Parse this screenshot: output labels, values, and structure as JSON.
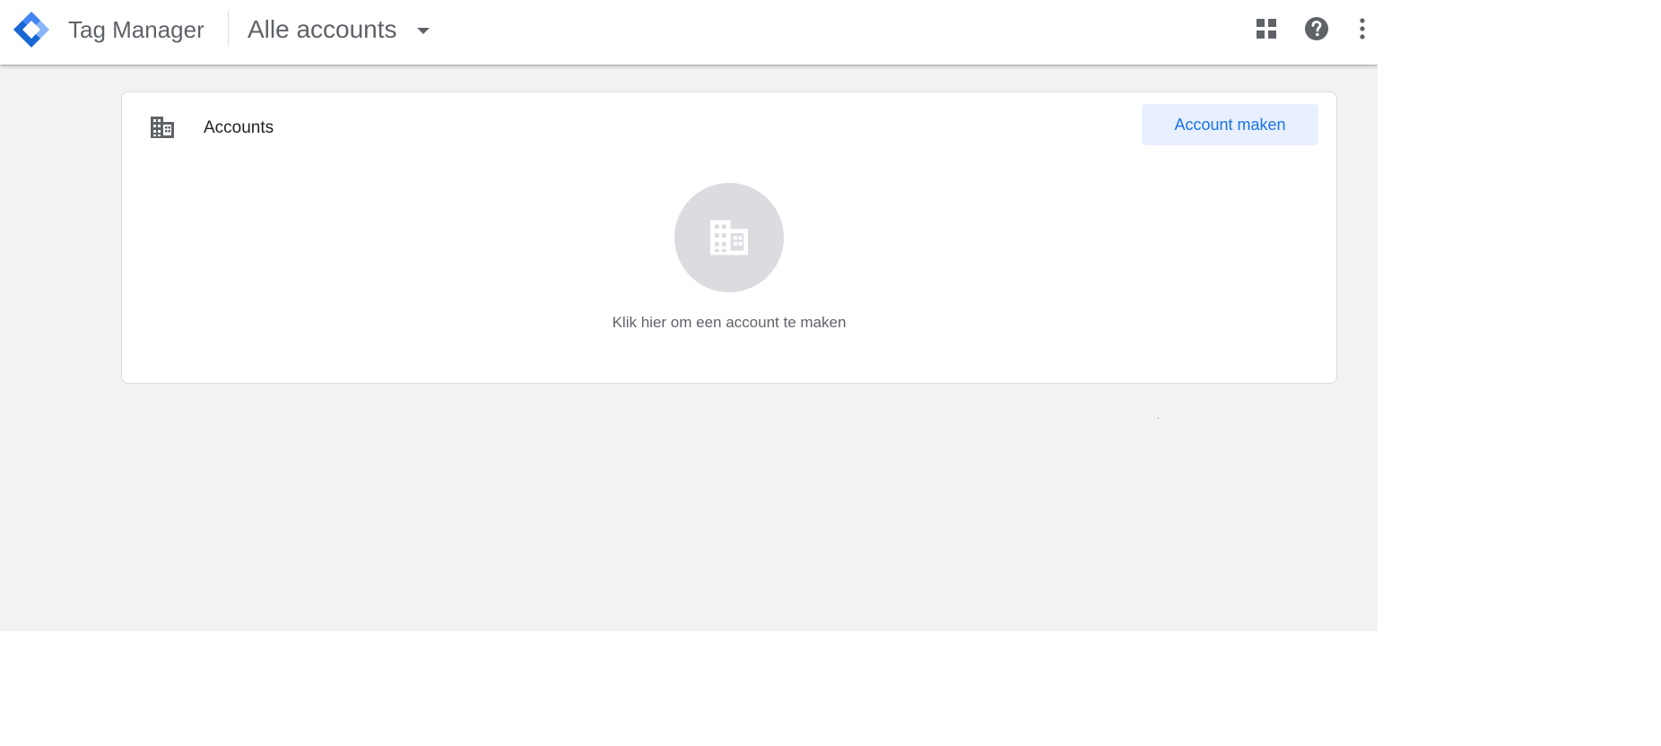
{
  "header": {
    "product_name": "Tag Manager",
    "account_switcher_label": "Alle accounts",
    "icons": {
      "logo": "tag-manager-logo",
      "switcher": "caret-down-icon",
      "apps": "apps-grid-icon",
      "help": "help-icon",
      "more": "more-vert-icon"
    }
  },
  "accounts_card": {
    "title": "Accounts",
    "title_icon": "building-icon",
    "create_button_label": "Account maken",
    "empty_state_icon": "building-icon",
    "empty_state_text": "Klik hier om een account te maken"
  },
  "colors": {
    "accent": "#1a73e8",
    "accent_light": "#e8f0fe",
    "logo_dark": "#1967d2",
    "logo_light": "#8ab4f8",
    "icon_grey": "#5f6368",
    "background": "#f1f2f4"
  }
}
